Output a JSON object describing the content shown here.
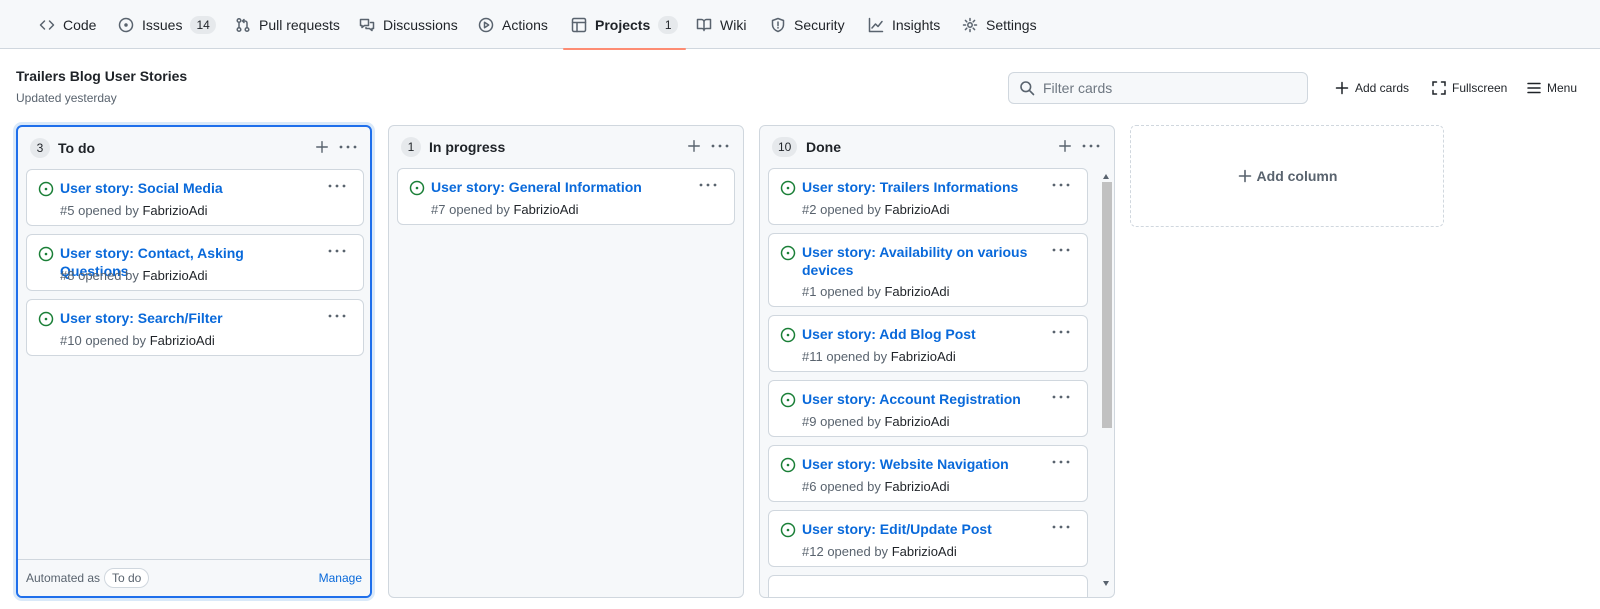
{
  "repo_nav": {
    "code": "Code",
    "issues": "Issues",
    "issues_count": "14",
    "pulls": "Pull requests",
    "discussions": "Discussions",
    "actions": "Actions",
    "projects": "Projects",
    "projects_count": "1",
    "wiki": "Wiki",
    "security": "Security",
    "insights": "Insights",
    "settings": "Settings",
    "selected": "Projects"
  },
  "project": {
    "title": "Trailers Blog User Stories",
    "updated": "Updated yesterday",
    "filter_placeholder": "Filter cards",
    "add_cards": "Add cards",
    "fullscreen": "Fullscreen",
    "menu": "Menu"
  },
  "columns": [
    {
      "count": "3",
      "name": "To do",
      "footer": {
        "automated_label": "Automated as",
        "automated_value": "To do",
        "manage": "Manage"
      },
      "cards": [
        {
          "title": "User story: Social Media",
          "number": "#5",
          "opened_by": "opened by",
          "author": "FabrizioAdi"
        },
        {
          "title": "User story: Contact, Asking Questions",
          "number": "#8",
          "opened_by": "opened by",
          "author": "FabrizioAdi"
        },
        {
          "title": "User story: Search/Filter",
          "number": "#10",
          "opened_by": "opened by",
          "author": "FabrizioAdi"
        }
      ]
    },
    {
      "count": "1",
      "name": "In progress",
      "cards": [
        {
          "title": "User story: General Information",
          "number": "#7",
          "opened_by": "opened by",
          "author": "FabrizioAdi"
        }
      ]
    },
    {
      "count": "10",
      "name": "Done",
      "cards": [
        {
          "title": "User story: Trailers Informations",
          "number": "#2",
          "opened_by": "opened by",
          "author": "FabrizioAdi"
        },
        {
          "title": "User story: Availability on various devices",
          "number": "#1",
          "opened_by": "opened by",
          "author": "FabrizioAdi"
        },
        {
          "title": "User story: Add Blog Post",
          "number": "#11",
          "opened_by": "opened by",
          "author": "FabrizioAdi"
        },
        {
          "title": "User story: Account Registration",
          "number": "#9",
          "opened_by": "opened by",
          "author": "FabrizioAdi"
        },
        {
          "title": "User story: Website Navigation",
          "number": "#6",
          "opened_by": "opened by",
          "author": "FabrizioAdi"
        },
        {
          "title": "User story: Edit/Update Post",
          "number": "#12",
          "opened_by": "opened by",
          "author": "FabrizioAdi"
        }
      ]
    }
  ],
  "add_column": "Add column",
  "colors": {
    "link": "#0969da",
    "open_issue": "#1a7f37",
    "focus_border": "#1f6feb",
    "selected_tab": "#fd8c73"
  }
}
